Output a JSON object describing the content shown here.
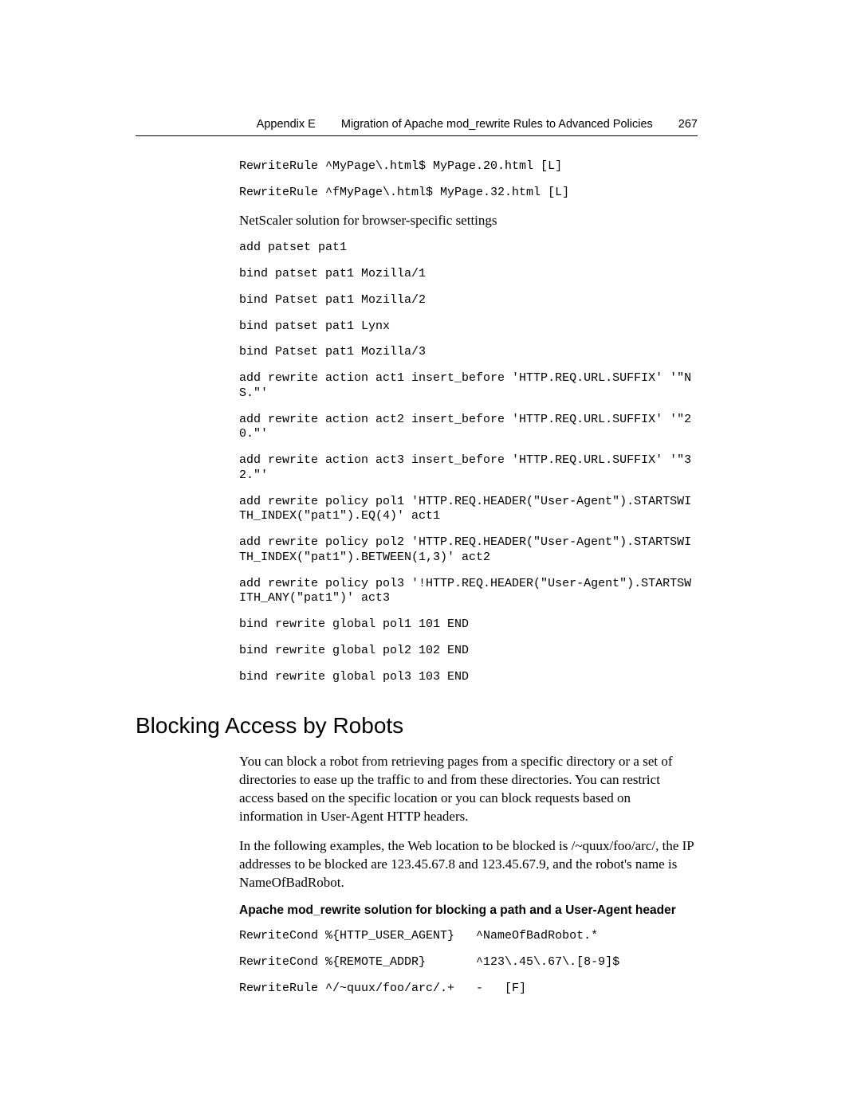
{
  "header": {
    "appendix": "Appendix  E",
    "title": "Migration of Apache mod_rewrite Rules to Advanced Policies",
    "page": "267"
  },
  "code_top": {
    "l1": "RewriteRule ^MyPage\\.html$ MyPage.20.html [L]",
    "l2": "RewriteRule ^fMyPage\\.html$ MyPage.32.html [L]"
  },
  "intro_line": "NetScaler solution for browser-specific settings",
  "ns_code": {
    "l1": "add patset pat1",
    "l2": "bind patset pat1 Mozilla/1",
    "l3": "bind Patset pat1 Mozilla/2",
    "l4": "bind patset pat1 Lynx",
    "l5": "bind Patset pat1 Mozilla/3",
    "l6": "add rewrite action act1 insert_before 'HTTP.REQ.URL.SUFFIX' '\"NS.\"'",
    "l7": "add rewrite action act2 insert_before 'HTTP.REQ.URL.SUFFIX' '\"20.\"'",
    "l8": "add rewrite action act3 insert_before 'HTTP.REQ.URL.SUFFIX' '\"32.\"'",
    "l9": "add rewrite policy pol1 'HTTP.REQ.HEADER(\"User-Agent\").STARTSWITH_INDEX(\"pat1\").EQ(4)' act1",
    "l10": "add rewrite policy pol2 'HTTP.REQ.HEADER(\"User-Agent\").STARTSWITH_INDEX(\"pat1\").BETWEEN(1,3)' act2",
    "l11": "add rewrite policy pol3 '!HTTP.REQ.HEADER(\"User-Agent\").STARTSWITH_ANY(\"pat1\")' act3",
    "l12": "bind rewrite global pol1 101 END",
    "l13": "bind rewrite global pol2 102 END",
    "l14": "bind rewrite global pol3 103 END"
  },
  "section_heading": "Blocking Access by Robots",
  "para1": "You can block a robot from retrieving pages from a specific directory or a set of directories to ease up the traffic to and from these directories. You can restrict access based on the specific location or you can block requests based on information in User-Agent HTTP headers.",
  "para2": "In the following examples, the Web location to be blocked is /~quux/foo/arc/, the IP addresses to be blocked are 123.45.67.8 and 123.45.67.9, and the robot's name is NameOfBadRobot.",
  "bold_label": "Apache mod_rewrite solution for blocking a path and a User-Agent header",
  "apache_code": {
    "l1": "RewriteCond %{HTTP_USER_AGENT}   ^NameOfBadRobot.*",
    "l2": "RewriteCond %{REMOTE_ADDR}       ^123\\.45\\.67\\.[8-9]$",
    "l3": "RewriteRule ^/~quux/foo/arc/.+   -   [F]"
  }
}
